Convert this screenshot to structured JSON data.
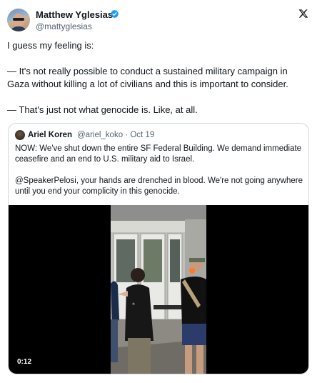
{
  "author": {
    "name": "Matthew Yglesias",
    "handle": "@mattyglesias",
    "verified": true
  },
  "tweet": {
    "lines": [
      "I guess my feeling is:",
      "— It's not really possible to conduct a sustained military campaign in",
      "Gaza without killing a lot of civilians and this is important to consider.",
      "— That's just not what genocide is. Like, at all."
    ]
  },
  "quoted": {
    "name": "Ariel Koren",
    "handle": "@ariel_koko",
    "separator": "·",
    "date": "Oct 19",
    "lines": [
      "NOW: We've shut down the entire SF Federal Building. We demand immediate",
      "ceasefire and an end to U.S. military aid to Israel.",
      "@SpeakerPelosi, your hands are drenched in blood. We're not going anywhere",
      "until you end your complicity in this genocide."
    ],
    "video": {
      "duration": "0:12"
    }
  },
  "colors": {
    "verified_blue": "#1d9bf0",
    "text": "#0f1419",
    "secondary": "#536471",
    "border": "#cfd9de"
  },
  "icons": {
    "verified": "verified-badge-icon",
    "platform": "x-logo-icon"
  }
}
